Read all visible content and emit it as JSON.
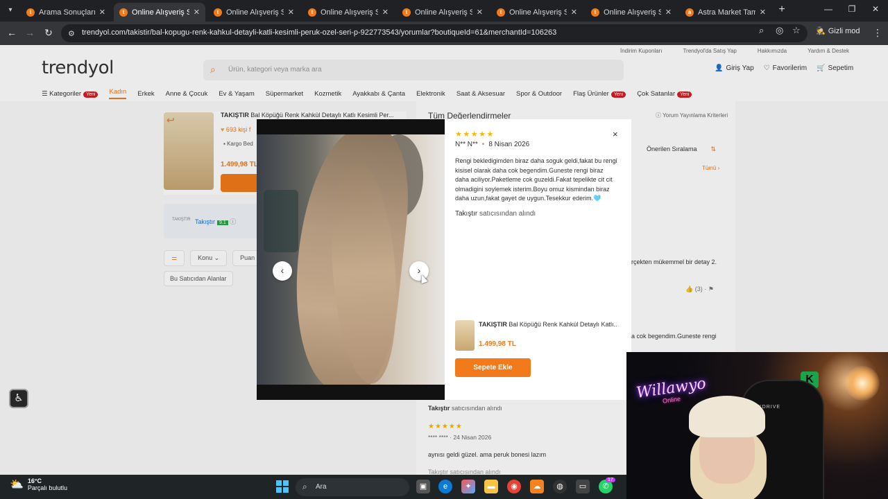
{
  "browser": {
    "tabs": [
      {
        "title": "Arama Sonuçları - Tr",
        "active": false
      },
      {
        "title": "Online Alışveriş Sites",
        "active": true
      },
      {
        "title": "Online Alışveriş Sites",
        "active": false
      },
      {
        "title": "Online Alışveriş Sites",
        "active": false
      },
      {
        "title": "Online Alışveriş Sites",
        "active": false
      },
      {
        "title": "Online Alışveriş Sites",
        "active": false
      },
      {
        "title": "Online Alışveriş Sites",
        "active": false
      },
      {
        "title": "Astra Market Tamtar",
        "active": false
      }
    ],
    "url": "trendyol.com/takistir/bal-kopugu-renk-kahkul-detayli-katli-kesimli-peruk-ozel-seri-p-922773543/yorumlar?boutiqueId=61&merchantId=106263",
    "incognito_label": "Gizli mod"
  },
  "site": {
    "logo": "trendyol",
    "top_links": [
      "İndirim Kuponları",
      "Trendyol'da Satış Yap",
      "Hakkımızda",
      "Yardım & Destek"
    ],
    "search_placeholder": "Ürün, kategori veya marka ara",
    "user_actions": {
      "login": "Giriş Yap",
      "favorites": "Favorilerim",
      "cart": "Sepetim"
    },
    "categories": [
      {
        "label": "Kategoriler",
        "badge": "Yeni"
      },
      {
        "label": "Kadın",
        "active": true
      },
      {
        "label": "Erkek"
      },
      {
        "label": "Anne & Çocuk"
      },
      {
        "label": "Ev & Yaşam"
      },
      {
        "label": "Süpermarket"
      },
      {
        "label": "Kozmetik"
      },
      {
        "label": "Ayakkabı & Çanta"
      },
      {
        "label": "Elektronik"
      },
      {
        "label": "Saat & Aksesuar"
      },
      {
        "label": "Spor & Outdoor"
      },
      {
        "label": "Flaş Ürünler",
        "badge": "Yeni"
      },
      {
        "label": "Çok Satanlar",
        "badge": "Yeni"
      }
    ]
  },
  "background": {
    "product_brand": "TAKIŞTIR",
    "product_title": "Bal Köpüğü Renk Kahkül Detaylı Katlı Kesimli Per...",
    "favorites_text": "693 kişi f",
    "cargo_text": "Kargo Bed",
    "price": "1.499,98 TL",
    "seller_name": "Takıştır",
    "seller_score": "9.1",
    "filters": [
      "Konu",
      "Puan"
    ],
    "seller_areas": "Bu Satıcıdan Alanlar",
    "reviews_title": "Tüm Değerlendirmeler",
    "criteria_link": "Yorum Yayınlama Kriterleri",
    "sort_label": "Önerilen Sıralama",
    "all_link": "Tümü",
    "partial_text_1": "erçekten mükemmel bir detay 2.",
    "likes": "(3)",
    "partial_text_2": "ha cok begendim.Guneste rengi",
    "review_seller_brand": "Takıştır",
    "review_seller_suffix": "satıcısından alındı",
    "review2_stars": "★★★★★",
    "review2_author": "**** ****",
    "review2_date": "24 Nisan 2026",
    "review2_body": "aynısı geldi güzel. ama peruk bonesi lazım",
    "review2_seller": "Takıştır satıcısından alındı"
  },
  "modal": {
    "stars": "★★★★★",
    "author": "N** N**",
    "date": "8 Nisan 2026",
    "body": "Rengi bekledigimden biraz daha soguk geldi,fakat bu rengi kisisel olarak daha cok begendim.Guneste rengi biraz daha aciliyor.Paketleme cok guzeldi.Fakat tepelikte cit cit olmadigini soylemek isterim.Boyu omuz kismindan biraz daha uzun,fakat gayet de uygun.Tesekkur ederim.🩵",
    "seller_brand": "Takıştır",
    "seller_suffix": "satıcısından alındı",
    "product_brand": "TAKIŞTIR",
    "product_title": "Bal Köpüğü Renk Kahkül Detaylı Katlı...",
    "price": "1.499,98 TL",
    "cart_button": "Sepete Ekle",
    "close_icon": "×"
  },
  "webcam": {
    "neon_text": "Willawyo",
    "neon_sub": "Online",
    "chair_brand": "XDRIVE",
    "platform_logo": "K"
  },
  "taskbar": {
    "temperature": "16°C",
    "weather_desc": "Parçalı bulutlu",
    "search_label": "Ara",
    "notification_count": "17"
  },
  "colors": {
    "brand_orange": "#f27a1a",
    "star_yellow": "#f6b800",
    "badge_red": "#d21f26"
  }
}
